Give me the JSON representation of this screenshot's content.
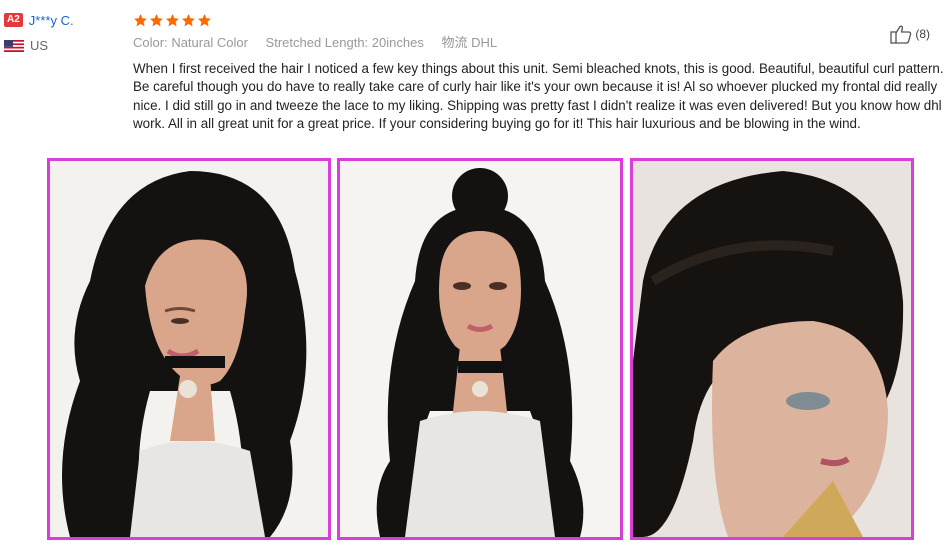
{
  "user": {
    "level_badge": "A2",
    "name": "J***y C.",
    "country": "US"
  },
  "review": {
    "stars": 5,
    "attributes": [
      {
        "key": "Color:",
        "value": "Natural Color"
      },
      {
        "key": "Stretched Length:",
        "value": "20inches"
      },
      {
        "key": "",
        "value": "物流 DHL"
      }
    ],
    "text": "When I first received the hair I noticed a few key things about this unit. Semi bleached knots, this is good. Beautiful, beautiful curl pattern. Be careful though you do have to really take care of curly hair like it's your own because it is! Al so whoever plucked my frontal did really nice. I did still go in and tweeze the lace to my liking. Shipping was pretty fast I didn't realize it was even delivered! But you know how dhl work. All in all great unit for a great price. If your considering buying go for it! This hair luxurious and be blowing in the wind.",
    "helpful_count": "(8)"
  },
  "colors": {
    "badge": "#e4393c",
    "username": "#1e63c8",
    "star": "#ff6a00",
    "photo_border": "#d83fd8"
  },
  "photos": [
    {
      "icon": "review-photo-1"
    },
    {
      "icon": "review-photo-2"
    },
    {
      "icon": "review-photo-3"
    }
  ]
}
